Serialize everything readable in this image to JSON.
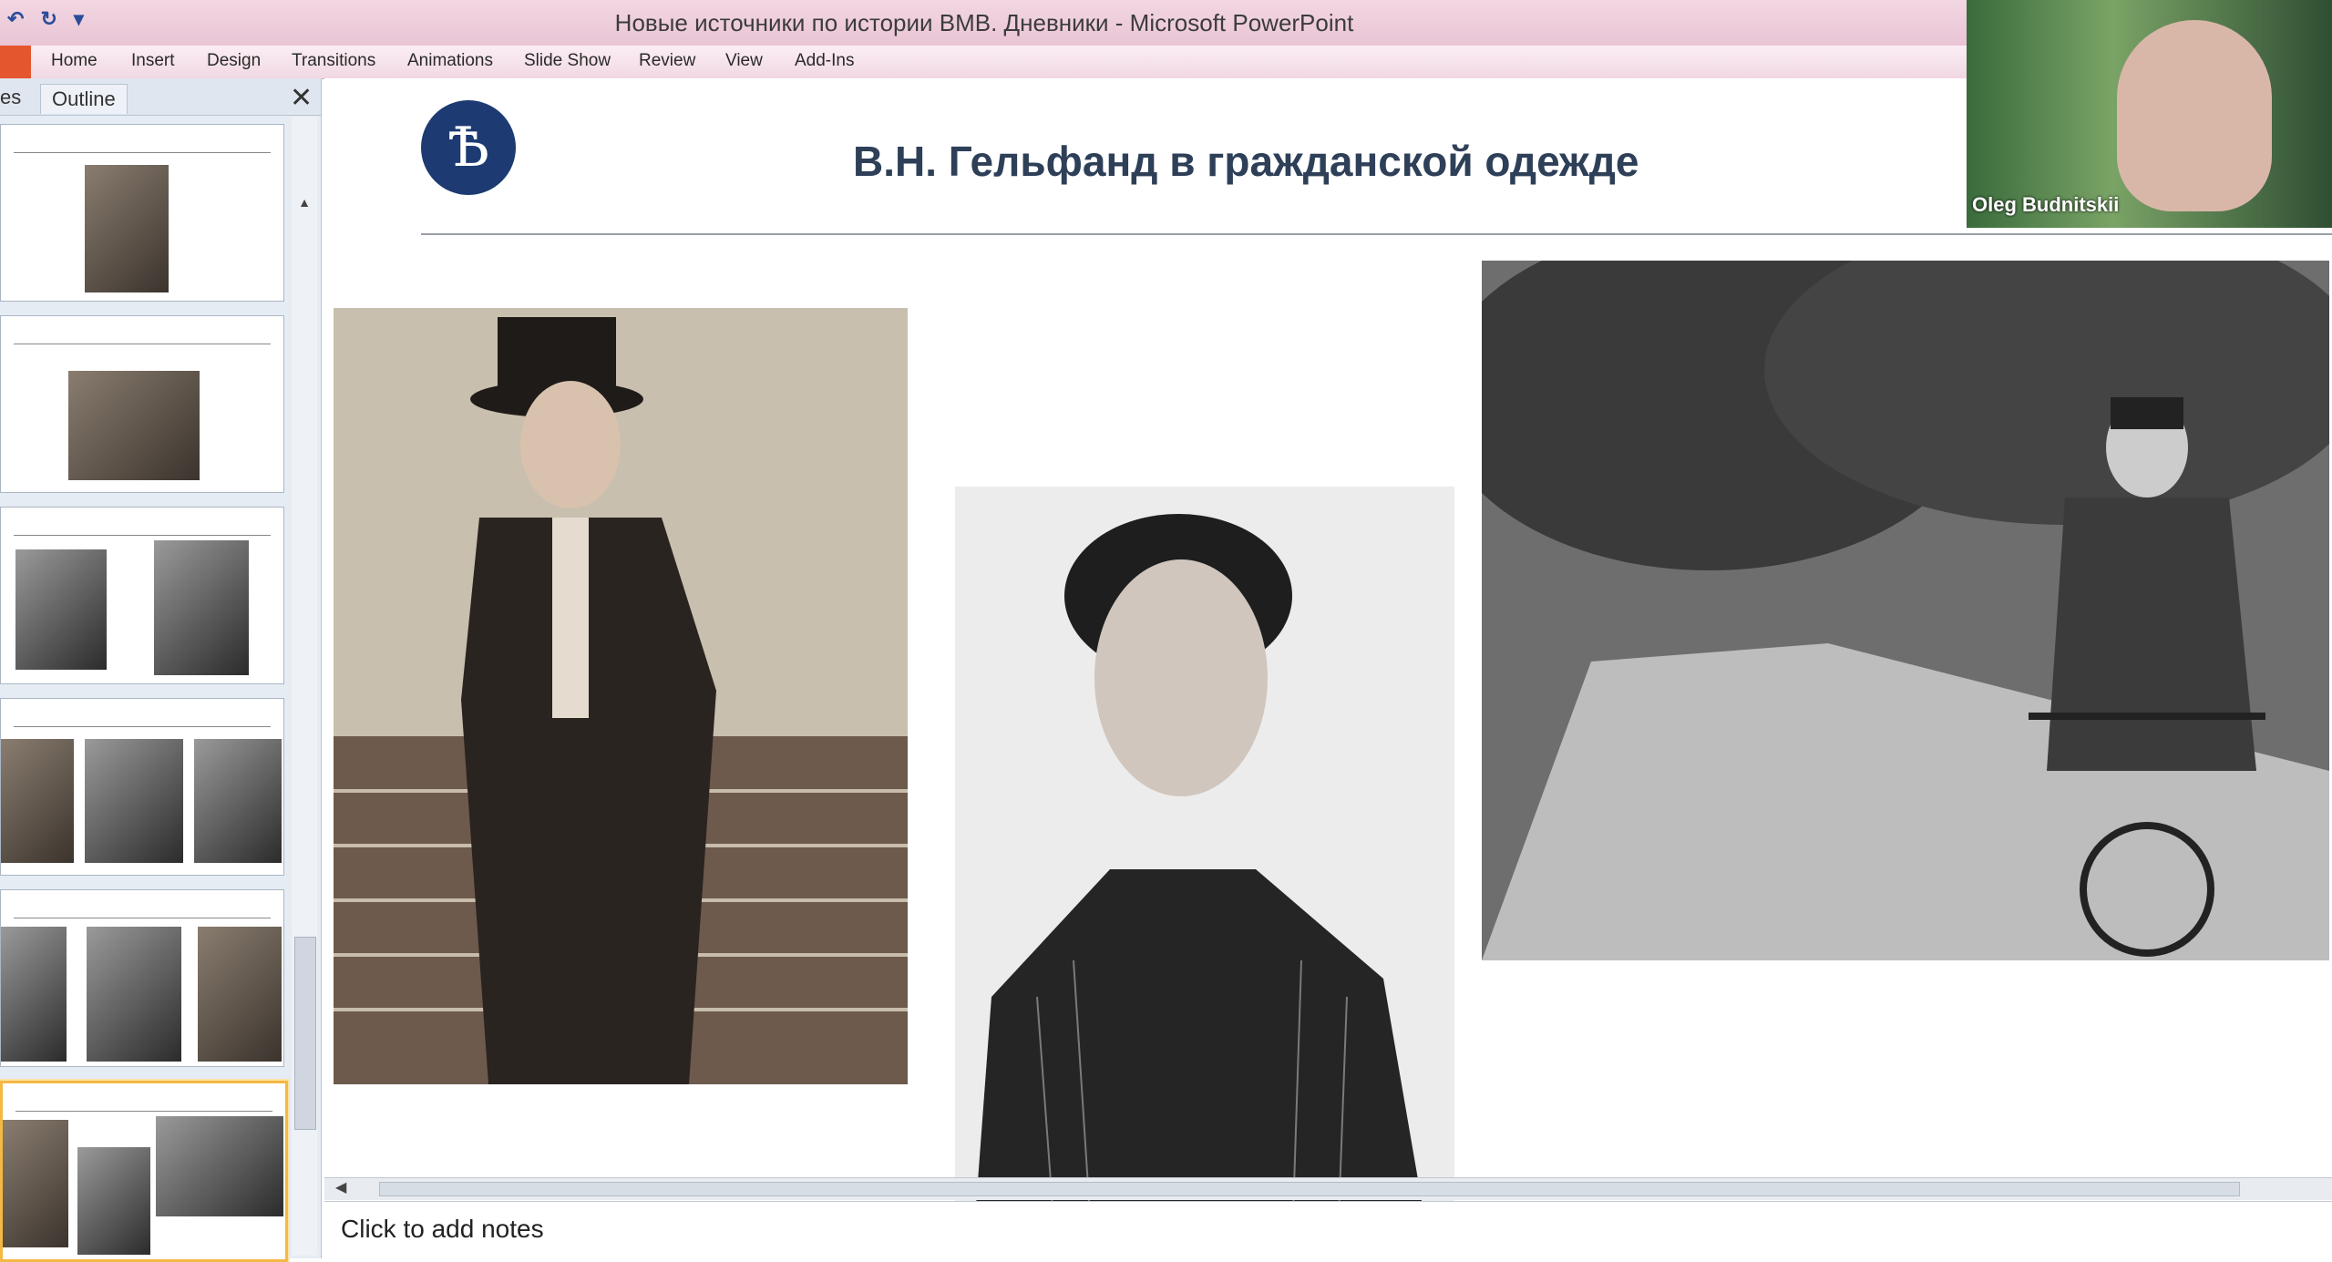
{
  "window": {
    "title": "Новые источники по истории ВМВ. Дневники  -  Microsoft PowerPoint"
  },
  "quick_access": {
    "undo_glyph": "↶",
    "redo_glyph": "↻",
    "more_glyph": "▾"
  },
  "ribbon": {
    "tabs": [
      "Home",
      "Insert",
      "Design",
      "Transitions",
      "Animations",
      "Slide Show",
      "Review",
      "View",
      "Add-Ins"
    ]
  },
  "left_panel": {
    "tabs": {
      "slides_partial": "es",
      "outline": "Outline"
    },
    "close_glyph": "✕",
    "scroll_up_glyph": "▲"
  },
  "slide": {
    "logo_text": "Ѣ",
    "title": "В.Н. Гельфанд в гражданской одежде",
    "photos": [
      "tophat",
      "portrait",
      "bicycle"
    ]
  },
  "notes": {
    "placeholder": "Click to add notes"
  },
  "hscroll": {
    "left_glyph": "◀"
  },
  "webcam": {
    "participant_name": "Oleg Budnitskii"
  },
  "colors": {
    "titlebar": "#e9c4d4",
    "slide_title": "#2e3f58",
    "logo": "#1d3b72",
    "selected_thumb": "#f4b844"
  }
}
